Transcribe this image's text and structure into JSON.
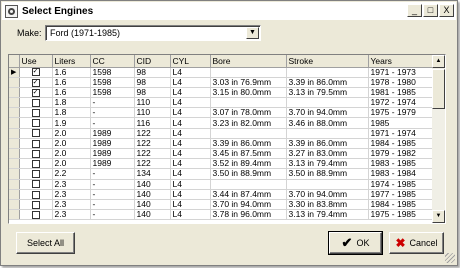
{
  "window": {
    "title": "Select Engines",
    "buttons": [
      "_",
      "□",
      "X"
    ]
  },
  "make": {
    "label": "Make:",
    "value": "Ford (1971-1985)"
  },
  "grid": {
    "columns": [
      "Use",
      "Liters",
      "CC",
      "CID",
      "CYL",
      "Bore",
      "Stroke",
      "Years"
    ],
    "rows": [
      {
        "use": true,
        "liters": "1.6",
        "cc": "1598",
        "cid": "98",
        "cyl": "L4",
        "bore": "",
        "stroke": "",
        "years": "1971 - 1973"
      },
      {
        "use": true,
        "liters": "1.6",
        "cc": "1598",
        "cid": "98",
        "cyl": "L4",
        "bore": "3.03 in 76.9mm",
        "stroke": "3.39 in 86.0mm",
        "years": "1978 - 1980"
      },
      {
        "use": true,
        "liters": "1.6",
        "cc": "1598",
        "cid": "98",
        "cyl": "L4",
        "bore": "3.15 in 80.0mm",
        "stroke": "3.13 in 79.5mm",
        "years": "1981 - 1985"
      },
      {
        "use": false,
        "liters": "1.8",
        "cc": "-",
        "cid": "110",
        "cyl": "L4",
        "bore": "",
        "stroke": "",
        "years": "1972 - 1974"
      },
      {
        "use": false,
        "liters": "1.8",
        "cc": "-",
        "cid": "110",
        "cyl": "L4",
        "bore": "3.07 in 78.0mm",
        "stroke": "3.70 in 94.0mm",
        "years": "1975 - 1979"
      },
      {
        "use": false,
        "liters": "1.9",
        "cc": "-",
        "cid": "116",
        "cyl": "L4",
        "bore": "3.23 in 82.0mm",
        "stroke": "3.46 in 88.0mm",
        "years": "1985"
      },
      {
        "use": false,
        "liters": "2.0",
        "cc": "1989",
        "cid": "122",
        "cyl": "L4",
        "bore": "",
        "stroke": "",
        "years": "1971 - 1974"
      },
      {
        "use": false,
        "liters": "2.0",
        "cc": "1989",
        "cid": "122",
        "cyl": "L4",
        "bore": "3.39 in 86.0mm",
        "stroke": "3.39 in 86.0mm",
        "years": "1984 - 1985"
      },
      {
        "use": false,
        "liters": "2.0",
        "cc": "1989",
        "cid": "122",
        "cyl": "L4",
        "bore": "3.45 in 87.5mm",
        "stroke": "3.27 in 83.0mm",
        "years": "1979 - 1982"
      },
      {
        "use": false,
        "liters": "2.0",
        "cc": "1989",
        "cid": "122",
        "cyl": "L4",
        "bore": "3.52 in 89.4mm",
        "stroke": "3.13 in 79.4mm",
        "years": "1983 - 1985"
      },
      {
        "use": false,
        "liters": "2.2",
        "cc": "-",
        "cid": "134",
        "cyl": "L4",
        "bore": "3.50 in 88.9mm",
        "stroke": "3.50 in 88.9mm",
        "years": "1983 - 1984"
      },
      {
        "use": false,
        "liters": "2.3",
        "cc": "-",
        "cid": "140",
        "cyl": "L4",
        "bore": "",
        "stroke": "",
        "years": "1974 - 1985"
      },
      {
        "use": false,
        "liters": "2.3",
        "cc": "-",
        "cid": "140",
        "cyl": "L4",
        "bore": "3.44 in 87.4mm",
        "stroke": "3.70 in 94.0mm",
        "years": "1977 - 1985"
      },
      {
        "use": false,
        "liters": "2.3",
        "cc": "-",
        "cid": "140",
        "cyl": "L4",
        "bore": "3.70 in 94.0mm",
        "stroke": "3.30 in 83.8mm",
        "years": "1984 - 1985"
      },
      {
        "use": false,
        "liters": "2.3",
        "cc": "-",
        "cid": "140",
        "cyl": "L4",
        "bore": "3.78 in 96.0mm",
        "stroke": "3.13 in 79.4mm",
        "years": "1975 - 1985"
      }
    ]
  },
  "buttons": {
    "select_all": "Select All",
    "ok": "OK",
    "cancel": "Cancel"
  }
}
